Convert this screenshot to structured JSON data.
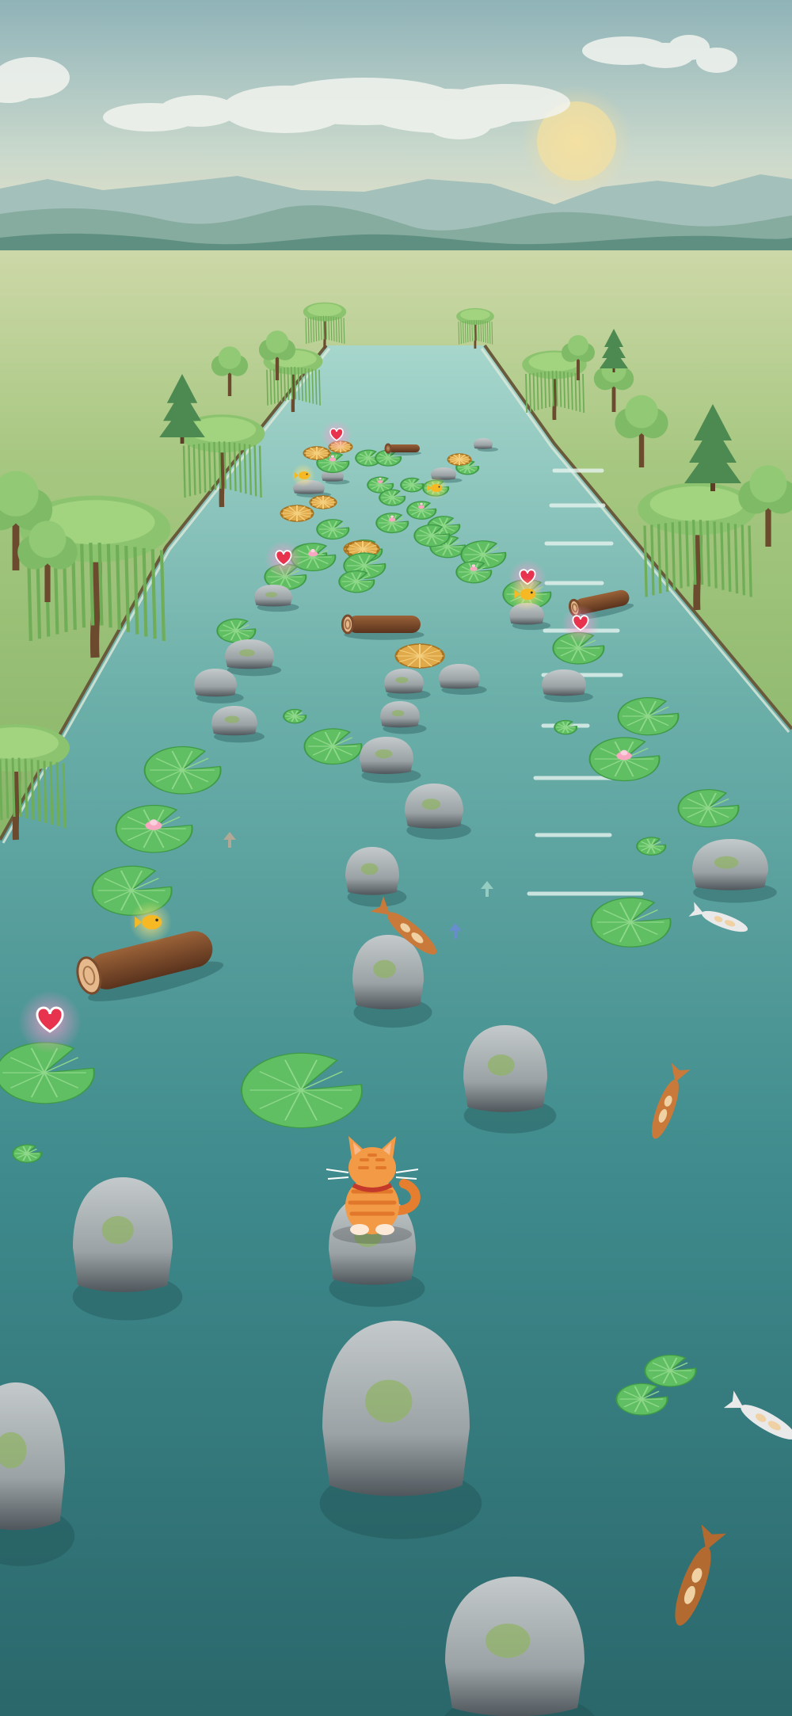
{
  "scene": {
    "sky_colors": [
      "#8fb3b8",
      "#c9d8cc",
      "#e9e2c6"
    ],
    "sun_color": "#f2dea0",
    "mountain_colors": [
      "#9bbab5",
      "#7fa79f",
      "#5f8f80"
    ],
    "grass_colors": [
      "#c9d6a4",
      "#9cc27a",
      "#86b86a"
    ],
    "water_colors": [
      "#9ed2c9",
      "#62a8a4",
      "#3b8387",
      "#2b6a6e"
    ],
    "rock_color": "#9aa3a6",
    "lilypad_color": "#5fbf62",
    "log_color": "#7a4a2c",
    "cat_color": "#f39a47"
  },
  "player": {
    "character": "orange-tabby-cat",
    "icon": "cat-icon"
  },
  "pickups": {
    "heart_icon": "heart-icon",
    "fish_icon": "goldfish-icon"
  }
}
